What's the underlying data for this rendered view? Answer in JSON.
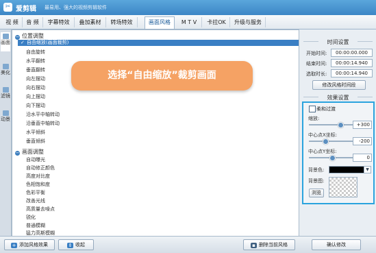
{
  "app": {
    "name": "爱剪辑",
    "slogan": "最易用、强大的视频剪辑软件"
  },
  "menu": [
    "视 频",
    "音 频",
    "字幕特效",
    "叠加素材",
    "转场特效",
    "画面风格",
    "M T V",
    "卡拉OK",
    "升级与服务"
  ],
  "vtabs": [
    "画面",
    "美化",
    "滤镜",
    "动景"
  ],
  "groups": [
    {
      "title": "位置调整",
      "items": [
        "自由缩放(画面裁剪)",
        "自由旋转",
        "水平翻转",
        "垂直翻转",
        "向左摆动",
        "向右摆动",
        "向上摆动",
        "向下摆动",
        "沿水平中轴转动",
        "沿垂直中轴转动",
        "水平倾斜",
        "垂直倾斜"
      ]
    },
    {
      "title": "画面调整",
      "items": [
        "自动曝光",
        "自动修正颜色",
        "高度对比度",
        "色相饱和度",
        "色彩平衡",
        "改善光线",
        "高质量去噪点",
        "锐化",
        "普通模糊",
        "猛力高斯模糊"
      ]
    }
  ],
  "selected_check": "✓",
  "callout": "选择“自由缩放”裁剪画面",
  "time_settings": {
    "title": "时间设置",
    "start_label": "开始时间:",
    "start_value": "00:00:00.000",
    "end_label": "结束时间:",
    "end_value": "00:00:14.940",
    "duration_label": "选取时长:",
    "duration_value": "00:00:14.940",
    "modify_button": "修改风格时间段"
  },
  "effect_settings": {
    "title": "效果设置",
    "soft_label": "柔和过渡",
    "zoom_label": "缩放:",
    "zoom_value": "+300",
    "cx_label": "中心点X坐标:",
    "cx_value": "-200",
    "cy_label": "中心点Y坐标:",
    "cy_value": "0",
    "bg_color_label": "背景色:",
    "bg_image_label": "背景图:",
    "browse_button": "浏览"
  },
  "bottom": {
    "add_button": "添加风格效果",
    "collapse_button": "收起",
    "delete_button": "删除当前风格",
    "confirm_button": "确认修改"
  }
}
